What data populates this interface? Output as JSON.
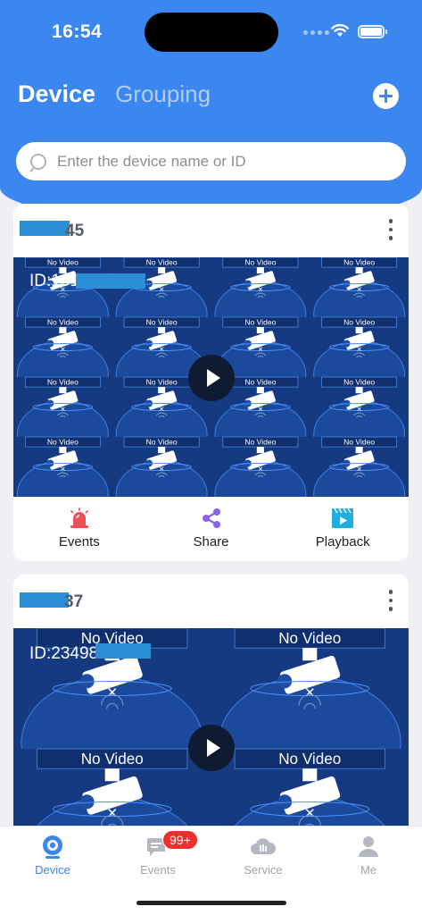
{
  "status": {
    "time": "16:54"
  },
  "header": {
    "tab_device": "Device",
    "tab_grouping": "Grouping",
    "add_icon": "plus-circle-icon"
  },
  "search": {
    "placeholder": "Enter the device name or ID",
    "value": ""
  },
  "devices": [
    {
      "name_suffix": "45",
      "id_text": "ID:1015",
      "grid": "4x4",
      "no_video_label": "No Video"
    },
    {
      "name_suffix": "37",
      "id_text": "ID:23498",
      "grid": "2x2",
      "no_video_label": "No Video"
    }
  ],
  "actions": {
    "events": "Events",
    "share": "Share",
    "playback": "Playback"
  },
  "nav": {
    "device": "Device",
    "events": "Events",
    "events_badge": "99+",
    "service": "Service",
    "me": "Me"
  },
  "colors": {
    "primary": "#3b86ef",
    "alarm": "#f5505a",
    "share": "#8a63e8",
    "playback": "#1faee0",
    "badge": "#f0302f"
  }
}
